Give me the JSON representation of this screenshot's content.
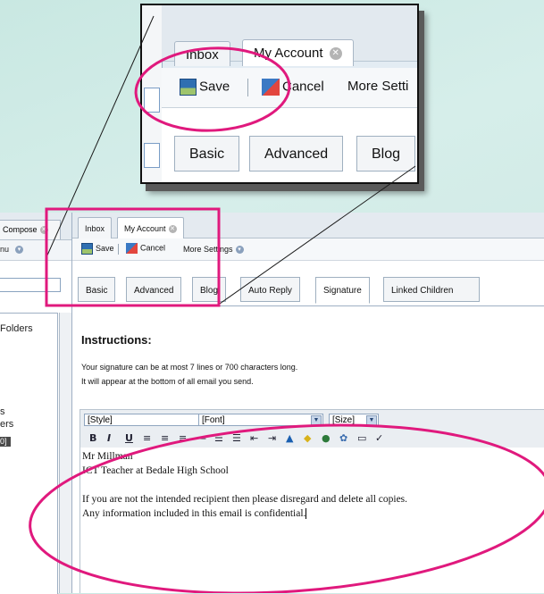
{
  "zoom": {
    "tabs": [
      "Inbox",
      "My Account"
    ],
    "toolbar": {
      "save": "Save",
      "cancel": "Cancel",
      "more": "More Setti"
    },
    "subtabs": [
      "Basic",
      "Advanced",
      "Blog"
    ]
  },
  "left": {
    "tab_compose": "Compose",
    "row2_label": "nu",
    "folders_label": "Folders",
    "count": "0]",
    "item_s": "s",
    "item_ers": "ers"
  },
  "tabs": {
    "inbox": "Inbox",
    "account": "My Account"
  },
  "toolbar": {
    "save": "Save",
    "cancel": "Cancel",
    "more": "More Settings"
  },
  "subtabs": [
    "Basic",
    "Advanced",
    "Blog",
    "Auto Reply",
    "Signature",
    "Linked Children"
  ],
  "instructions": {
    "title": "Instructions:",
    "line1": "Your signature can be at most 7 lines or 700 characters long.",
    "line2": "It will appear at the bottom of all email you send."
  },
  "editor": {
    "style": "[Style]",
    "font": "[Font]",
    "size": "[Size]",
    "format_buttons": [
      "B",
      "I",
      "U"
    ]
  },
  "signature": {
    "line1": "Mr Millman",
    "line2": "ICT Teacher at Bedale High School",
    "line3": "If you are not the intended recipient then please disregard and delete all copies.",
    "line4": "Any information included in this email is confidential."
  },
  "colors": {
    "highlight": "#e0197d",
    "frame": "#9fb0c4"
  }
}
